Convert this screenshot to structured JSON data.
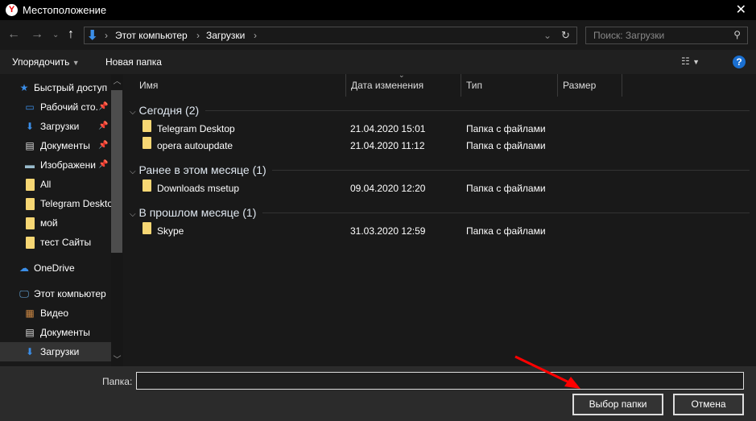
{
  "title": "Местоположение",
  "nav": {
    "path": [
      "Этот компьютер",
      "Загрузки"
    ],
    "search_placeholder": "Поиск: Загрузки"
  },
  "toolbar": {
    "organize": "Упорядочить",
    "new_folder": "Новая папка"
  },
  "sidebar": {
    "items": [
      {
        "label": "Быстрый доступ",
        "icon": "star-icon",
        "level": 0,
        "pinned": false
      },
      {
        "label": "Рабочий сто.",
        "icon": "desktop-icon",
        "level": 1,
        "pinned": true
      },
      {
        "label": "Загрузки",
        "icon": "download-icon",
        "level": 1,
        "pinned": true
      },
      {
        "label": "Документы",
        "icon": "document-icon",
        "level": 1,
        "pinned": true
      },
      {
        "label": "Изображени",
        "icon": "image-icon",
        "level": 1,
        "pinned": true
      },
      {
        "label": "All",
        "icon": "folder-icon",
        "level": 1,
        "pinned": false
      },
      {
        "label": "Telegram Deskto",
        "icon": "folder-icon",
        "level": 1,
        "pinned": false
      },
      {
        "label": "мой",
        "icon": "folder-icon",
        "level": 1,
        "pinned": false
      },
      {
        "label": "тест Сайты",
        "icon": "folder-icon",
        "level": 1,
        "pinned": false
      },
      {
        "label": "OneDrive",
        "icon": "cloud-icon",
        "level": 0,
        "pinned": false
      },
      {
        "label": "Этот компьютер",
        "icon": "computer-icon",
        "level": 0,
        "pinned": false
      },
      {
        "label": "Видео",
        "icon": "video-icon",
        "level": 1,
        "pinned": false
      },
      {
        "label": "Документы",
        "icon": "document-icon",
        "level": 1,
        "pinned": false
      },
      {
        "label": "Загрузки",
        "icon": "download-icon",
        "level": 1,
        "pinned": false
      }
    ]
  },
  "columns": [
    "Имя",
    "Дата изменения",
    "Тип",
    "Размер"
  ],
  "groups": [
    {
      "label": "Сегодня (2)",
      "rows": [
        {
          "name": "Telegram Desktop",
          "date": "21.04.2020 15:01",
          "type": "Папка с файлами"
        },
        {
          "name": "opera autoupdate",
          "date": "21.04.2020 11:12",
          "type": "Папка с файлами"
        }
      ]
    },
    {
      "label": "Ранее в этом месяце (1)",
      "rows": [
        {
          "name": "Downloads msetup",
          "date": "09.04.2020 12:20",
          "type": "Папка с файлами"
        }
      ]
    },
    {
      "label": "В прошлом месяце (1)",
      "rows": [
        {
          "name": "Skype",
          "date": "31.03.2020 12:59",
          "type": "Папка с файлами"
        }
      ]
    }
  ],
  "bottom": {
    "folder_label": "Папка:",
    "folder_value": "",
    "select_button": "Выбор папки",
    "cancel_button": "Отмена"
  }
}
